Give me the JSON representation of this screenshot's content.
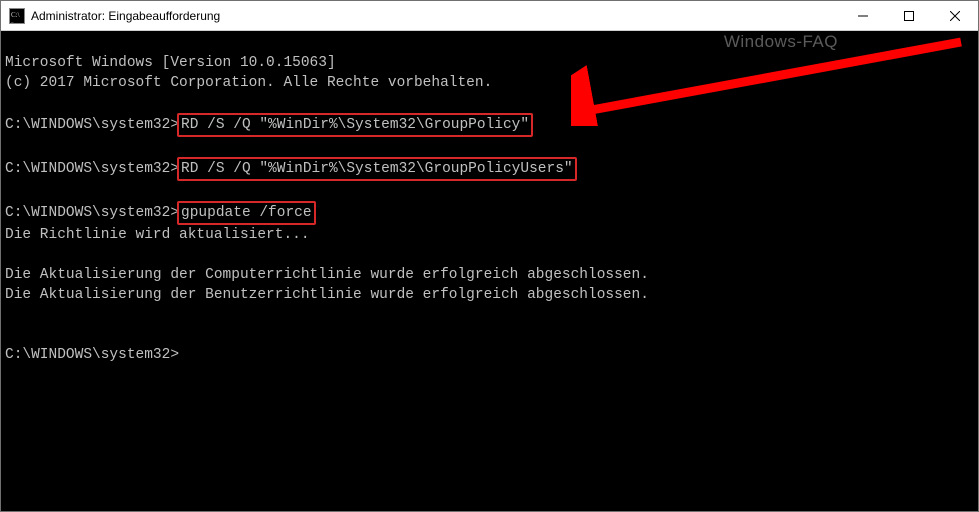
{
  "titlebar": {
    "title": "Administrator: Eingabeaufforderung",
    "watermark": "Windows-FAQ"
  },
  "terminal": {
    "header1": "Microsoft Windows [Version 10.0.15063]",
    "header2": "(c) 2017 Microsoft Corporation. Alle Rechte vorbehalten.",
    "prompt": "C:\\WINDOWS\\system32>",
    "cmd1": "RD /S /Q \"%WinDir%\\System32\\GroupPolicy\"",
    "cmd2": "RD /S /Q \"%WinDir%\\System32\\GroupPolicyUsers\"",
    "cmd3": "gpupdate /force",
    "output1": "Die Richtlinie wird aktualisiert...",
    "output2": "Die Aktualisierung der Computerrichtlinie wurde erfolgreich abgeschlossen.",
    "output3": "Die Aktualisierung der Benutzerrichtlinie wurde erfolgreich abgeschlossen."
  },
  "colors": {
    "highlight": "#d62828",
    "arrow": "#ff0000"
  }
}
